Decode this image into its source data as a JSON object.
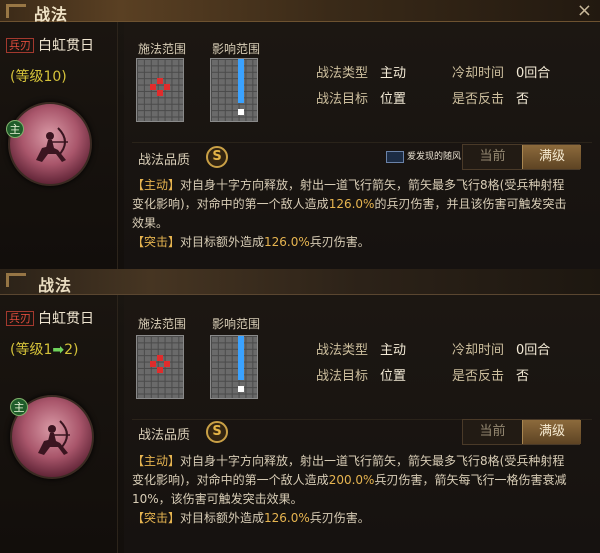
{
  "panels": [
    {
      "title": "战法",
      "close_icon": "×",
      "tag": "兵刃",
      "skill_name": "白虹贯日",
      "level_prefix": "(等级",
      "level_value": "10",
      "level_suffix": ")",
      "faction_badge": "主",
      "grid_labels": {
        "cast": "施法范围",
        "effect": "影响范围"
      },
      "fields": {
        "type_label": "战法类型",
        "type_value": "主动",
        "cooldown_label": "冷却时间",
        "cooldown_value": "0回合",
        "target_label": "战法目标",
        "target_value": "位置",
        "counter_label": "是否反击",
        "counter_value": "否"
      },
      "quality_label": "战法品质",
      "quality_value": "S",
      "watermark": "爱发现的随风",
      "toggle": {
        "current": "当前",
        "max": "满级"
      },
      "desc": {
        "active_kw": "【主动】",
        "active_text_1": "对自身十字方向释放，射出一道飞行箭矢，箭矢最多飞行8格(受兵种射程变化影响)，对命中的第一个敌人造成",
        "active_num": "126.0%",
        "active_text_2": "的兵刃伤害，并且该伤害可触发突击效果。",
        "assault_kw": "【突击】",
        "assault_text_1": "对目标额外造成",
        "assault_num": "126.0%",
        "assault_text_2": "兵刃伤害。"
      }
    },
    {
      "title": "战法",
      "tag": "兵刃",
      "skill_name": "白虹贯日",
      "level_prefix": "(等级",
      "level_from": "1",
      "level_arrow": "➡",
      "level_to": "2",
      "level_suffix": ")",
      "faction_badge": "主",
      "grid_labels": {
        "cast": "施法范围",
        "effect": "影响范围"
      },
      "fields": {
        "type_label": "战法类型",
        "type_value": "主动",
        "cooldown_label": "冷却时间",
        "cooldown_value": "0回合",
        "target_label": "战法目标",
        "target_value": "位置",
        "counter_label": "是否反击",
        "counter_value": "否"
      },
      "quality_label": "战法品质",
      "quality_value": "S",
      "toggle": {
        "current": "当前",
        "max": "满级"
      },
      "desc": {
        "active_kw": "【主动】",
        "active_text_1": "对自身十字方向释放，射出一道飞行箭矢，箭矢最多飞行8格(受兵种射程变化影响)，对命中的第一个敌人造成",
        "active_num": "200.0%",
        "active_text_2": "兵刃伤害，箭矢每飞行一格伤害衰减10%，该伤害可触发突击效果。",
        "assault_kw": "【突击】",
        "assault_text_1": "对目标额外造成",
        "assault_num": "126.0%",
        "assault_text_2": "兵刃伤害。"
      }
    }
  ],
  "colors": {
    "accent_gold": "#e6b450",
    "tag_red": "#e04c3c",
    "level_yellow": "#d4c23a",
    "grid_red": "#e02c2c",
    "grid_blue": "#3aa2ff"
  }
}
